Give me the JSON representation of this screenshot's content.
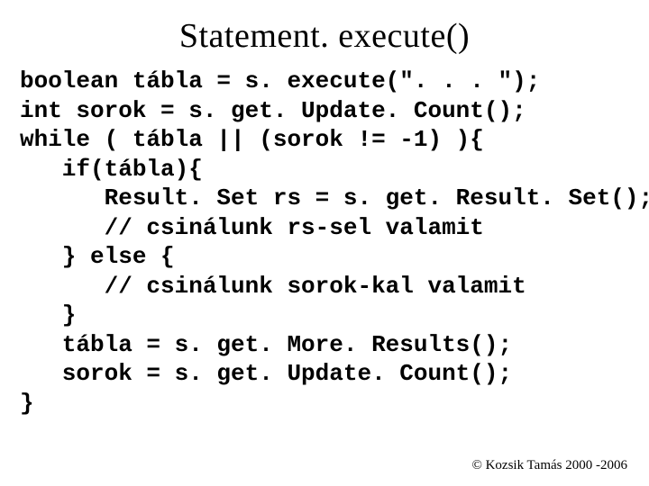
{
  "title": "Statement. execute()",
  "code": "boolean tábla = s. execute(\". . . \");\nint sorok = s. get. Update. Count();\nwhile ( tábla || (sorok != -1) ){\n   if(tábla){\n      Result. Set rs = s. get. Result. Set();\n      // csinálunk rs-sel valamit\n   } else {\n      // csinálunk sorok-kal valamit\n   }\n   tábla = s. get. More. Results();\n   sorok = s. get. Update. Count();\n}",
  "footer": "© Kozsik Tamás 2000 -2006"
}
